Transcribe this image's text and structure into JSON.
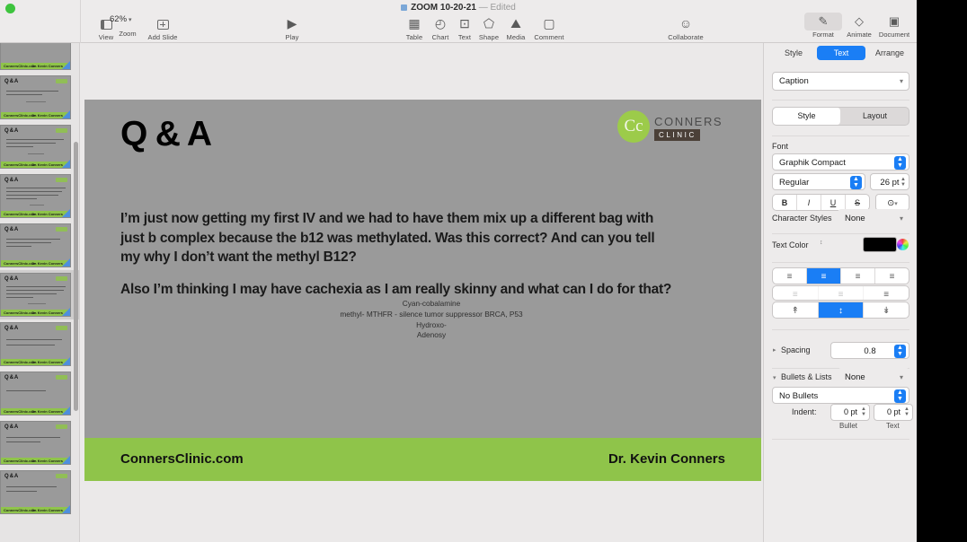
{
  "window": {
    "document_title": "ZOOM 10-20-21",
    "title_dash": "—",
    "edited_status": "Edited"
  },
  "toolbar": {
    "left_items": [
      {
        "label": "View",
        "icon": "view-sidebar-icon"
      },
      {
        "label": "Zoom",
        "icon": "zoom-icon",
        "value": "62%"
      },
      {
        "label": "Add Slide",
        "icon": "add-slide-icon"
      }
    ],
    "play": {
      "label": "Play",
      "icon": "play-icon",
      "glyph": "▶"
    },
    "insert_items": [
      {
        "label": "Table",
        "icon": "table-icon",
        "glyph": "▦"
      },
      {
        "label": "Chart",
        "icon": "chart-icon",
        "glyph": "◴"
      },
      {
        "label": "Text",
        "icon": "text-box-icon",
        "glyph": "⊡"
      },
      {
        "label": "Shape",
        "icon": "shape-icon",
        "glyph": "⬠"
      },
      {
        "label": "Media",
        "icon": "media-icon",
        "glyph": "⛰"
      },
      {
        "label": "Comment",
        "icon": "comment-icon",
        "glyph": "▢"
      }
    ],
    "collaborate": {
      "label": "Collaborate",
      "icon": "collaborate-icon",
      "glyph": "☺"
    },
    "right_items": [
      {
        "label": "Format",
        "icon": "format-brush-icon",
        "glyph": "✎",
        "active": true
      },
      {
        "label": "Animate",
        "icon": "animate-diamond-icon",
        "glyph": "◇",
        "active": false
      },
      {
        "label": "Document",
        "icon": "document-icon",
        "glyph": "▣",
        "active": false
      }
    ]
  },
  "inspector": {
    "tabs": [
      {
        "label": "Style",
        "selected": false
      },
      {
        "label": "Text",
        "selected": true
      },
      {
        "label": "Arrange",
        "selected": false
      }
    ],
    "style_preset": "Caption",
    "style_layout_toggle": [
      {
        "label": "Style",
        "selected": true
      },
      {
        "label": "Layout",
        "selected": false
      }
    ],
    "font_section_label": "Font",
    "font_family": "Graphik Compact",
    "font_weight": "Regular",
    "font_size": "26 pt",
    "text_style_buttons": [
      {
        "label": "B",
        "name": "bold"
      },
      {
        "label": "I",
        "name": "italic"
      },
      {
        "label": "U",
        "name": "underline"
      },
      {
        "label": "S",
        "name": "strikethrough"
      }
    ],
    "text_options_glyph": "⊙",
    "character_styles_label": "Character Styles",
    "character_styles_value": "None",
    "text_color_label": "Text Color",
    "text_color_value": "#000000",
    "alignment": [
      {
        "name": "align-left",
        "glyph": "☰",
        "selected": false
      },
      {
        "name": "align-center",
        "glyph": "☰",
        "selected": true
      },
      {
        "name": "align-right",
        "glyph": "☰",
        "selected": false
      },
      {
        "name": "align-justify",
        "glyph": "☰",
        "selected": false
      }
    ],
    "indent": [
      {
        "name": "decrease-indent",
        "glyph": "≡",
        "selected": false
      },
      {
        "name": "increase-indent",
        "glyph": "≡",
        "selected": false
      },
      {
        "name": "text-indent-option",
        "glyph": "≡",
        "selected": false
      }
    ],
    "vertical_alignment": [
      {
        "name": "align-top",
        "glyph": "⤒",
        "selected": false
      },
      {
        "name": "align-middle",
        "glyph": "↕",
        "selected": true
      },
      {
        "name": "align-bottom",
        "glyph": "⤓",
        "selected": false
      }
    ],
    "spacing_label": "Spacing",
    "spacing_value": "0.8",
    "bullets_label": "Bullets & Lists",
    "bullets_value": "None",
    "bullets_preset": "No Bullets",
    "indent_label": "Indent:",
    "indent_bullet_value": "0 pt",
    "indent_text_value": "0 pt",
    "indent_bullet_caption": "Bullet",
    "indent_text_caption": "Text"
  },
  "slide": {
    "title": "Q & A",
    "logo": {
      "monogram": "Cc",
      "brand_top": "CONNERS",
      "brand_bottom": "CLINIC",
      "green": "#9ccb4a",
      "brown": "#4b4038"
    },
    "paragraph_1": "I’m just now getting my first IV and we had to have them mix up a different bag with just b complex because the b12 was methylated. Was this correct? And can you tell my why I don’t want the methyl B12?",
    "paragraph_2": "Also I’m thinking I may have cachexia as I am really skinny and what can I do for that?",
    "caption_lines": [
      "Cyan-cobalamine",
      "methyl- MTHFR - silence tumor suppressor BRCA, P53",
      "Hydroxo-",
      "Adenosy"
    ],
    "footer_left": "ConnersClinic.com",
    "footer_right": "Dr. Kevin Conners",
    "background_color": "#9a9a9a",
    "footer_color": "#8fc44a"
  },
  "navigator": {
    "thumbnails": [
      {
        "title": "",
        "footer_left": "ConnersClinic.com",
        "footer_right": "Dr. Kevin Conners",
        "selected": false,
        "lines": 0
      },
      {
        "title": "Q & A",
        "footer_left": "ConnersClinic.com",
        "footer_right": "Dr. Kevin Conners",
        "selected": false,
        "lines": 2
      },
      {
        "title": "Q & A",
        "footer_left": "ConnersClinic.com",
        "footer_right": "Dr. Kevin Conners",
        "selected": false,
        "lines": 3
      },
      {
        "title": "Q & A",
        "footer_left": "ConnersClinic.com",
        "footer_right": "Dr. Kevin Conners",
        "selected": false,
        "lines": 4
      },
      {
        "title": "Q & A",
        "footer_left": "ConnersClinic.com",
        "footer_right": "Dr. Kevin Conners",
        "selected": false,
        "lines": 3
      },
      {
        "title": "Q & A",
        "footer_left": "ConnersClinic.com",
        "footer_right": "Dr. Kevin Conners",
        "selected": true,
        "lines": 4
      },
      {
        "title": "Q & A",
        "footer_left": "ConnersClinic.com",
        "footer_right": "Dr. Kevin Conners",
        "selected": false,
        "lines": 2
      },
      {
        "title": "Q & A",
        "footer_left": "ConnersClinic.com",
        "footer_right": "Dr. Kevin Conners",
        "selected": false,
        "lines": 1
      },
      {
        "title": "Q & A",
        "footer_left": "ConnersClinic.com",
        "footer_right": "Dr. Kevin Conners",
        "selected": false,
        "lines": 2
      },
      {
        "title": "Q & A",
        "footer_left": "ConnersClinic.com",
        "footer_right": "Dr. Kevin Conners",
        "selected": false,
        "lines": 2
      }
    ]
  }
}
